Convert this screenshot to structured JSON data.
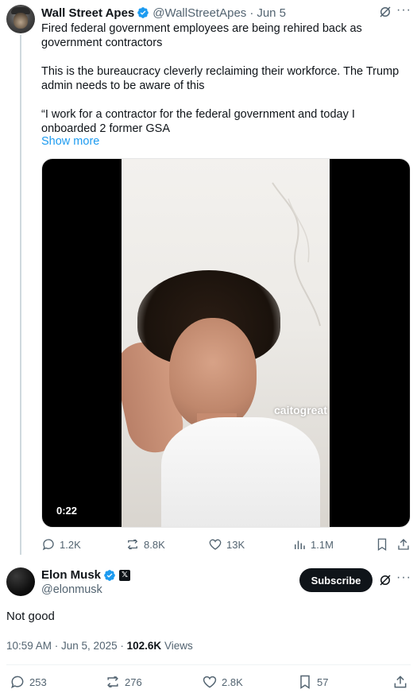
{
  "parent_tweet": {
    "author_name": "Wall Street Apes",
    "author_handle": "@WallStreetApes",
    "date": "Jun 5",
    "text_line1": "Fired federal government employees are being rehired back as government contractors",
    "text_line2": "This is the bureaucracy cleverly reclaiming their workforce. The Trump admin needs to be aware of this",
    "text_line3": "“I work for a contractor for the federal government and today I onboarded 2 former GSA",
    "show_more": "Show more",
    "video": {
      "watermark": "caitogreat",
      "duration": "0:22"
    },
    "stats": {
      "replies": "1.2K",
      "reposts": "8.8K",
      "likes": "13K",
      "views": "1.1M"
    }
  },
  "reply_tweet": {
    "author_name": "Elon Musk",
    "author_handle": "@elonmusk",
    "subscribe_label": "Subscribe",
    "text": "Not good",
    "timestamp": "10:59 AM · Jun 5, 2025",
    "views_count": "102.6K",
    "views_label": "Views",
    "stats": {
      "replies": "253",
      "reposts": "276",
      "likes": "2.8K",
      "bookmarks": "57"
    }
  },
  "colors": {
    "accent": "#1d9bf0",
    "text_primary": "#0f1419",
    "text_secondary": "#536471",
    "thread_line": "#cfd9de"
  },
  "icons": [
    "verified-badge-icon",
    "grok-icon",
    "more-icon",
    "reply-icon",
    "repost-icon",
    "like-icon",
    "views-icon",
    "bookmark-icon",
    "share-icon"
  ]
}
